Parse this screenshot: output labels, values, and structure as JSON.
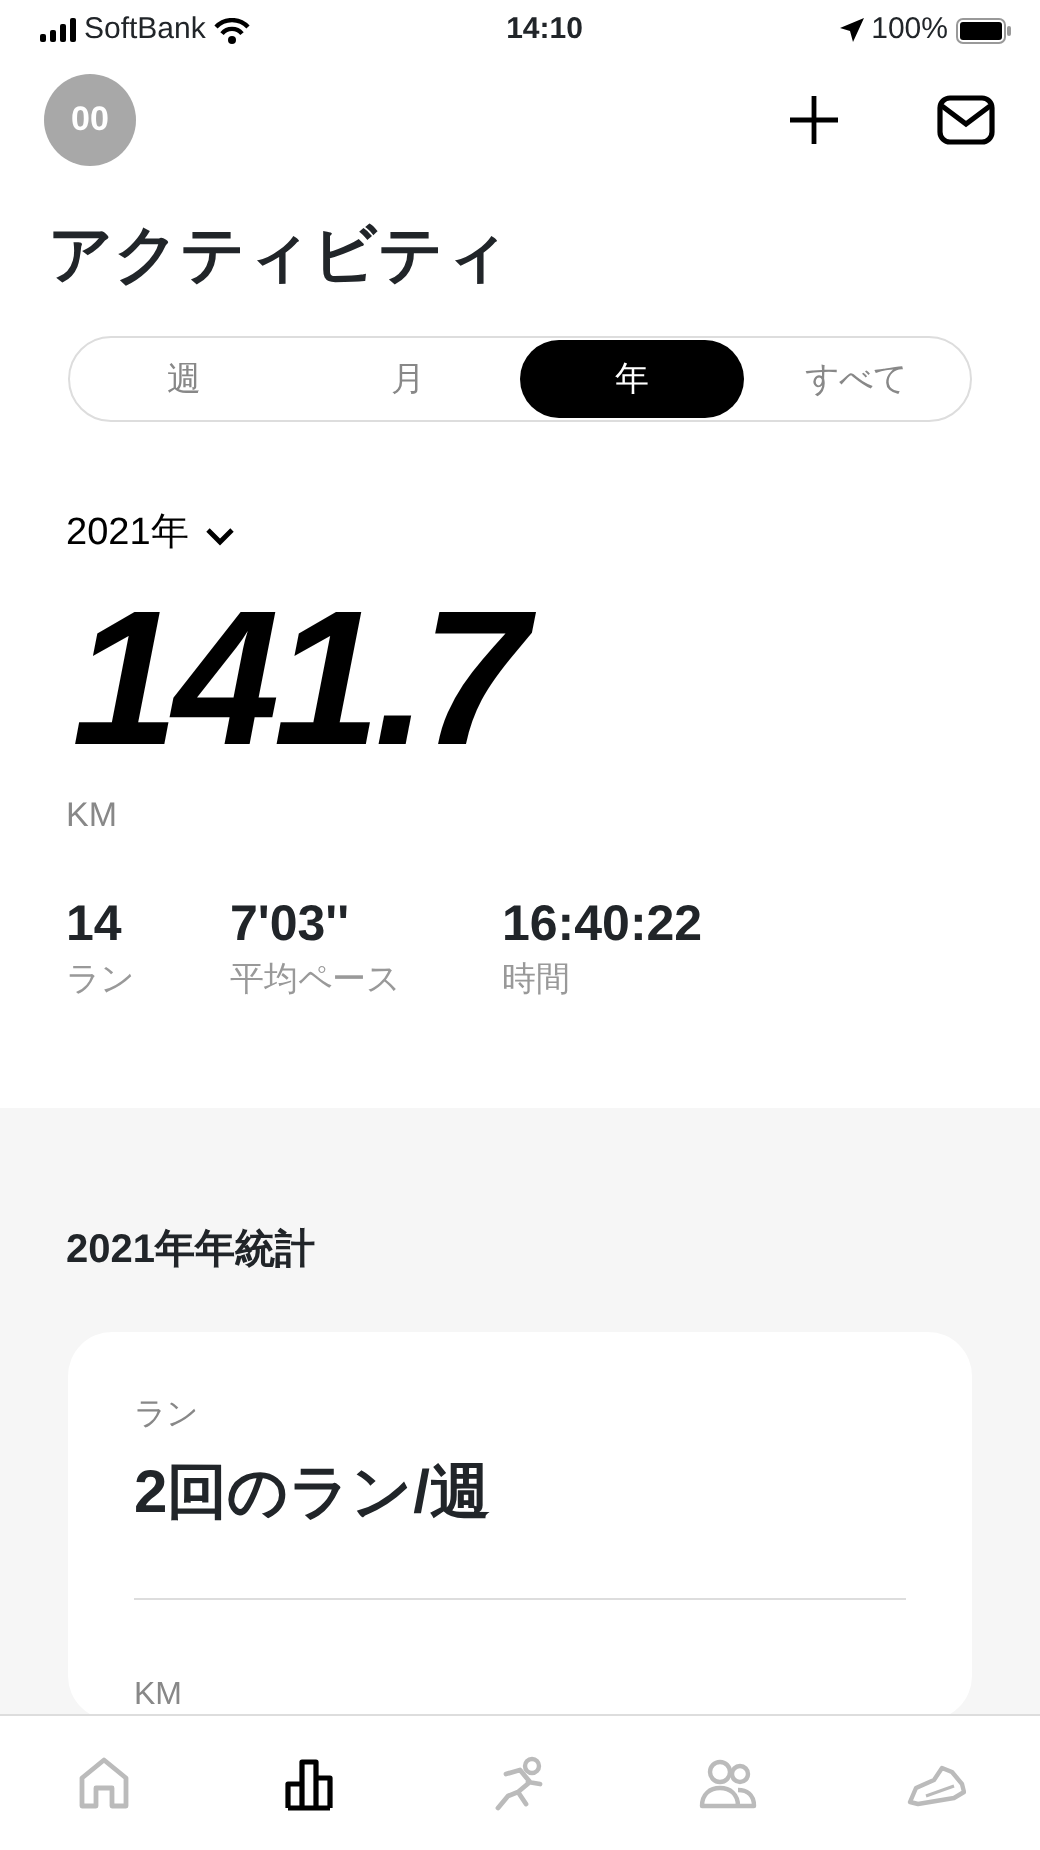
{
  "status_bar": {
    "carrier": "SoftBank",
    "time": "14:10",
    "battery": "100%"
  },
  "header": {
    "avatar": "00"
  },
  "title": "アクティビティ",
  "periods": [
    {
      "label": "週",
      "selected": false
    },
    {
      "label": "月",
      "selected": false
    },
    {
      "label": "年",
      "selected": true
    },
    {
      "label": "すべて",
      "selected": false
    }
  ],
  "period_picker": {
    "value": "2021年"
  },
  "distance": {
    "value": "141.7",
    "unit": "KM"
  },
  "stats": [
    {
      "value": "14",
      "label": "ラン"
    },
    {
      "value": "7'03''",
      "label": "平均ペース"
    },
    {
      "value": "16:40:22",
      "label": "時間"
    }
  ],
  "yearly": {
    "title": "2021年年統計",
    "card": [
      {
        "label": "ラン",
        "value": "2回のラン/週"
      },
      {
        "label": "KM"
      }
    ]
  },
  "tab_bar": [
    {
      "kind": "home",
      "selected": false
    },
    {
      "kind": "activity",
      "selected": true
    },
    {
      "kind": "run",
      "selected": false
    },
    {
      "kind": "club",
      "selected": false
    },
    {
      "kind": "shoe",
      "selected": false
    }
  ]
}
